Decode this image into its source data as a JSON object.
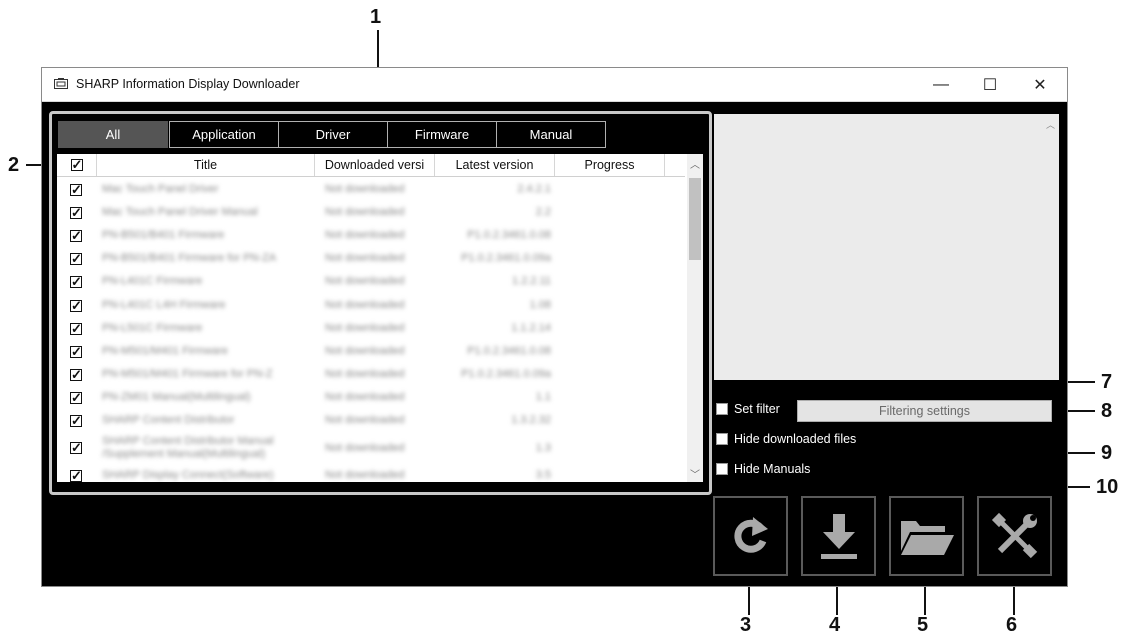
{
  "window": {
    "title": "SHARP Information Display Downloader",
    "minimize": "—",
    "maximize": "☐",
    "close": "✕"
  },
  "tabs": [
    "All",
    "Application",
    "Driver",
    "Firmware",
    "Manual"
  ],
  "active_tab": "All",
  "table": {
    "select_all_checked": true,
    "columns": [
      "Title",
      "Downloaded versi",
      "Latest version",
      "Progress"
    ],
    "rows": [
      {
        "checked": true,
        "title": "Mac Touch Panel Driver",
        "downloaded": "Not downloaded",
        "latest": "2.4.2.1"
      },
      {
        "checked": true,
        "title": "Mac Touch Panel Driver Manual",
        "downloaded": "Not downloaded",
        "latest": "2.2"
      },
      {
        "checked": true,
        "title": "PN-B501/B401 Firmware",
        "downloaded": "Not downloaded",
        "latest": "P1.0.2.3461.0.08"
      },
      {
        "checked": true,
        "title": "PN-B501/B401 Firmware for PN-ZA",
        "downloaded": "Not downloaded",
        "latest": "P1.0.2.3461.0.09a"
      },
      {
        "checked": true,
        "title": "PN-L401C Firmware",
        "downloaded": "Not downloaded",
        "latest": "1.2.2.11"
      },
      {
        "checked": true,
        "title": "PN-L401C L4H Firmware",
        "downloaded": "Not downloaded",
        "latest": "1.08"
      },
      {
        "checked": true,
        "title": "PN-L501C Firmware",
        "downloaded": "Not downloaded",
        "latest": "1.1.2.14"
      },
      {
        "checked": true,
        "title": "PN-M501/M401 Firmware",
        "downloaded": "Not downloaded",
        "latest": "P1.0.2.3461.0.08"
      },
      {
        "checked": true,
        "title": "PN-M501/M401 Firmware for PN-Z",
        "downloaded": "Not downloaded",
        "latest": "P1.0.2.3461.0.09a"
      },
      {
        "checked": true,
        "title": "PN-ZM01 Manual(Multilingual)",
        "downloaded": "Not downloaded",
        "latest": "1.1"
      },
      {
        "checked": true,
        "title": "SHARP Content Distributor",
        "downloaded": "Not downloaded",
        "latest": "1.3.2.32"
      },
      {
        "checked": true,
        "title": "SHARP Content Distributor Manual",
        "title2": "/Supplement Manual(Multilingual)",
        "downloaded": "Not downloaded",
        "latest": "1.3"
      },
      {
        "checked": true,
        "title": "SHARP Display Connect(Software)",
        "downloaded": "Not downloaded",
        "latest": "3.5"
      }
    ]
  },
  "options": {
    "set_filter": "Set filter",
    "filtering_settings": "Filtering settings",
    "hide_downloaded": "Hide downloaded files",
    "hide_manuals": "Hide Manuals"
  },
  "buttons": {
    "refresh": "refresh-icon",
    "download": "download-icon",
    "folder": "folder-icon",
    "settings": "tools-icon"
  },
  "callouts": [
    "1",
    "2",
    "3",
    "4",
    "5",
    "6",
    "7",
    "8",
    "9",
    "10"
  ],
  "colors": {
    "window_bg": "#000000",
    "active_tab": "#555555",
    "button_icon": "#a9a9a9"
  }
}
